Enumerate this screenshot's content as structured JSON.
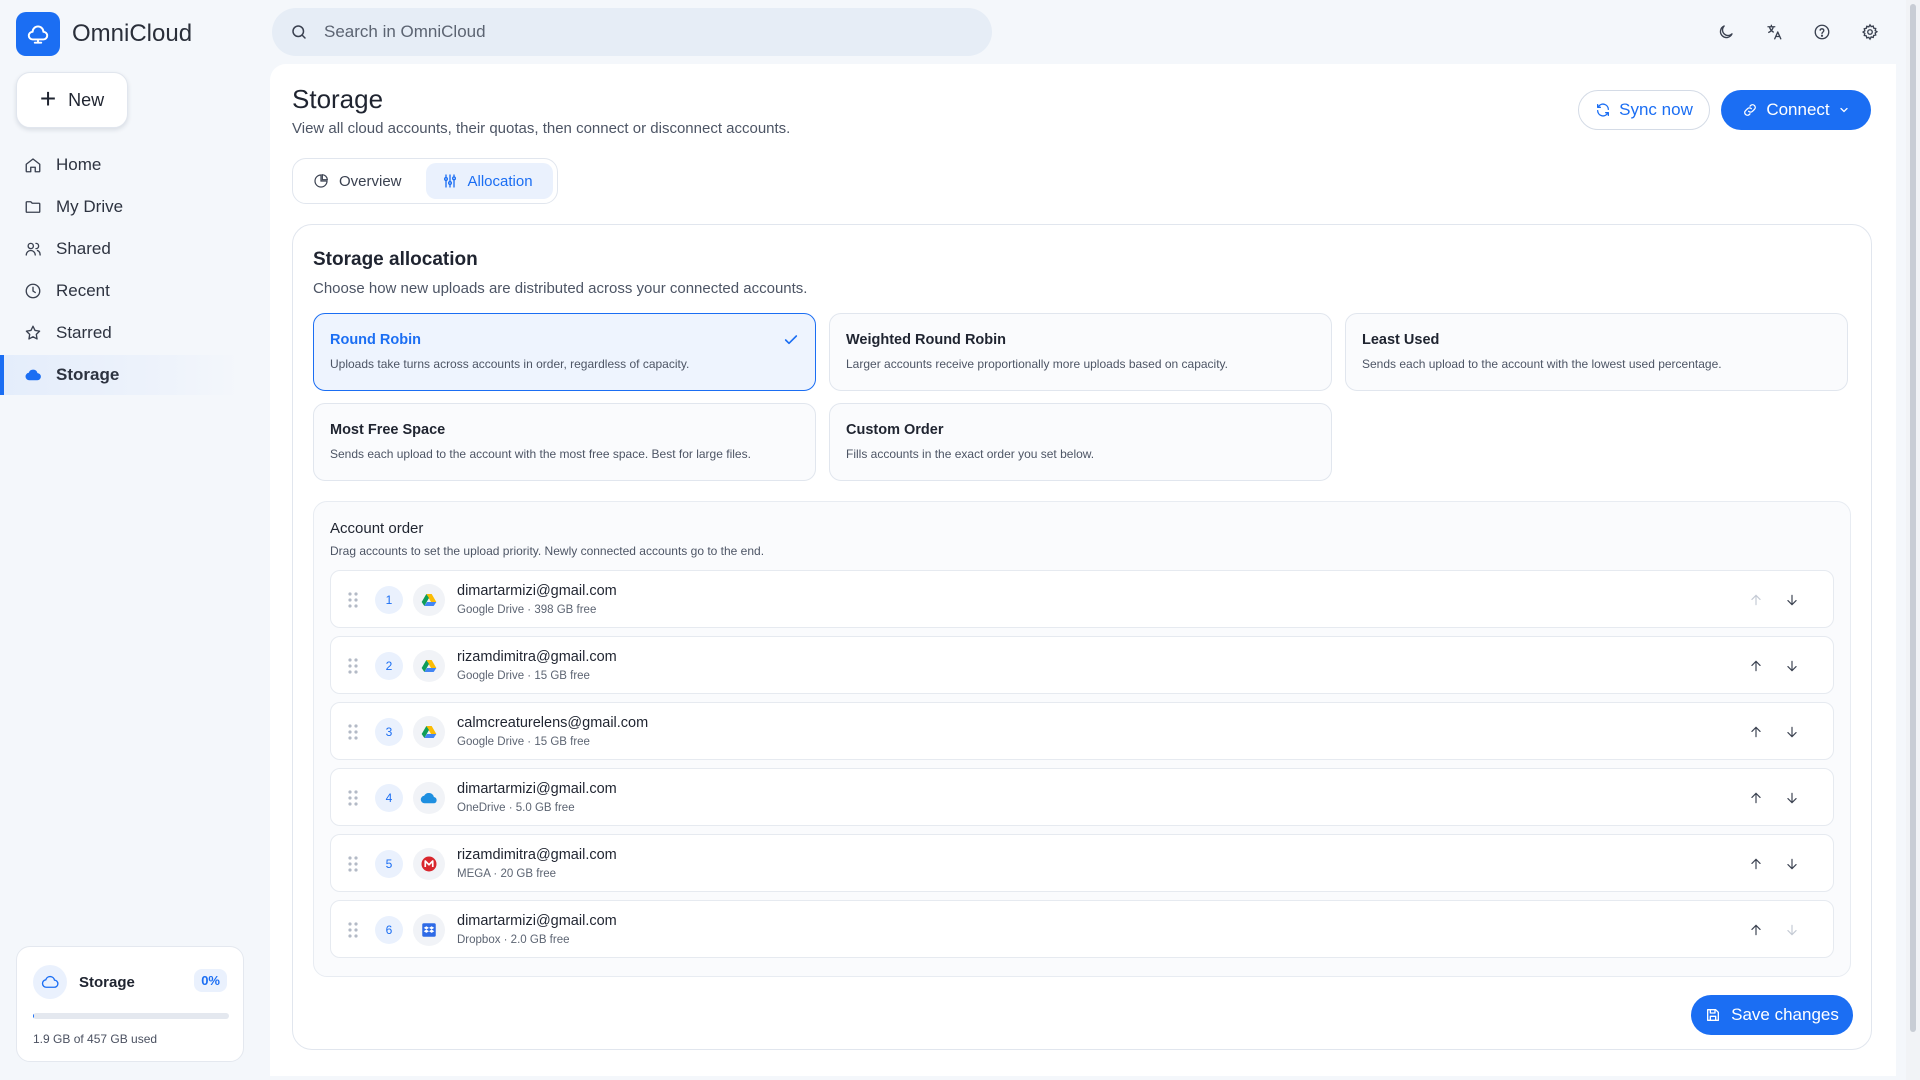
{
  "app": {
    "name": "OmniCloud",
    "brand_color": "#1b6ef3"
  },
  "new_button": {
    "label": "New"
  },
  "search": {
    "placeholder": "Search in OmniCloud"
  },
  "top_icons": [
    "dark-mode-icon",
    "translate-icon",
    "help-icon",
    "settings-icon"
  ],
  "sidebar": {
    "items": [
      {
        "label": "Home",
        "icon": "home-icon",
        "active": false
      },
      {
        "label": "My Drive",
        "icon": "folder-icon",
        "active": false
      },
      {
        "label": "Shared",
        "icon": "people-icon",
        "active": false
      },
      {
        "label": "Recent",
        "icon": "clock-icon",
        "active": false
      },
      {
        "label": "Starred",
        "icon": "star-icon",
        "active": false
      },
      {
        "label": "Storage",
        "icon": "cloud-icon",
        "active": true
      }
    ],
    "storage": {
      "title": "Storage",
      "percent_label": "0%",
      "used_fraction": 0.004,
      "used_text": "1.9 GB of 457 GB used"
    }
  },
  "header": {
    "title": "Storage",
    "subtitle": "View all cloud accounts, their quotas, then connect or disconnect accounts.",
    "sync_label": "Sync now",
    "connect_label": "Connect"
  },
  "tabs": [
    {
      "label": "Overview",
      "icon": "pie-chart-icon",
      "active": false
    },
    {
      "label": "Allocation",
      "icon": "sliders-icon",
      "active": true
    }
  ],
  "allocation": {
    "title": "Storage allocation",
    "subtitle": "Choose how new uploads are distributed across your connected accounts.",
    "strategies": [
      {
        "name": "Round Robin",
        "desc": "Uploads take turns across accounts in order, regardless of capacity.",
        "selected": true
      },
      {
        "name": "Weighted Round Robin",
        "desc": "Larger accounts receive proportionally more uploads based on capacity.",
        "selected": false
      },
      {
        "name": "Least Used",
        "desc": "Sends each upload to the account with the lowest used percentage.",
        "selected": false
      },
      {
        "name": "Most Free Space",
        "desc": "Sends each upload to the account with the most free space. Best for large files.",
        "selected": false
      },
      {
        "name": "Custom Order",
        "desc": "Fills accounts in the exact order you set below.",
        "selected": false
      }
    ],
    "order": {
      "title": "Account order",
      "subtitle": "Drag accounts to set the upload priority. Newly connected accounts go to the end.",
      "accounts": [
        {
          "num": "1",
          "email": "dimartarmizi@gmail.com",
          "meta": "Google Drive · 398 GB free",
          "provider": "google-drive"
        },
        {
          "num": "2",
          "email": "rizamdimitra@gmail.com",
          "meta": "Google Drive · 15 GB free",
          "provider": "google-drive"
        },
        {
          "num": "3",
          "email": "calmcreaturelens@gmail.com",
          "meta": "Google Drive · 15 GB free",
          "provider": "google-drive"
        },
        {
          "num": "4",
          "email": "dimartarmizi@gmail.com",
          "meta": "OneDrive · 5.0 GB free",
          "provider": "onedrive"
        },
        {
          "num": "5",
          "email": "rizamdimitra@gmail.com",
          "meta": "MEGA · 20 GB free",
          "provider": "mega"
        },
        {
          "num": "6",
          "email": "dimartarmizi@gmail.com",
          "meta": "Dropbox · 2.0 GB free",
          "provider": "dropbox"
        }
      ]
    },
    "save_label": "Save changes"
  }
}
